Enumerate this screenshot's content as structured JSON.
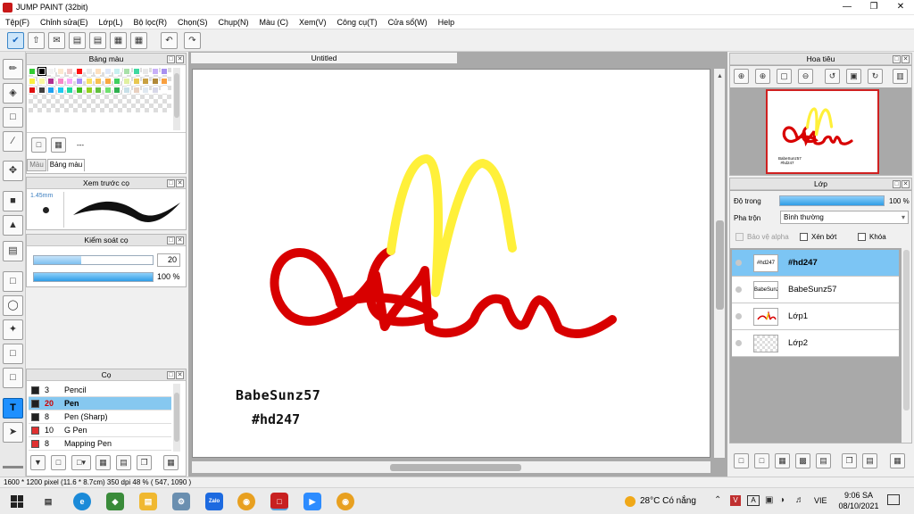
{
  "window": {
    "title": "JUMP PAINT (32bit)"
  },
  "menu": [
    "Tệp(F)",
    "Chỉnh sửa(E)",
    "Lớp(L)",
    "Bộ lọc(R)",
    "Chọn(S)",
    "Chụp(N)",
    "Màu (C)",
    "Xem(V)",
    "Công cụ(T)",
    "Cửa sổ(W)",
    "Help"
  ],
  "palette": {
    "title": "Bảng màu",
    "tabs": [
      "Màu",
      "Bảng màu"
    ],
    "dash": "---",
    "colors": [
      "#33cc33",
      "#000000",
      "#f4f4f4",
      "#fbe8d0",
      "#f4c8c8",
      "#ff1010",
      "#e8e8e8",
      "#fde0c0",
      "#e0e8f8",
      "#c8f0f0",
      "#a8e0a8",
      "#40d8a0",
      "#e8e8e8",
      "#c8b0f8",
      "#a890f0",
      "#f8f040",
      "#f8f8a0",
      "#b03090",
      "#f888c8",
      "#f8a8f8",
      "#a890f8",
      "#f8e060",
      "#f8c050",
      "#f8a840",
      "#40d060",
      "#e0f0a0",
      "#e8c850",
      "#c8a040",
      "#b08838",
      "#f8a040",
      "#e01010",
      "#404040",
      "#20a0f0",
      "#20c8f0",
      "#20d8a0",
      "#40c020",
      "#90d020",
      "#60c040",
      "#70e070",
      "#30b050",
      "#c8e0e8",
      "#e8d0c0",
      "#e0e8f0",
      "#d8d8e8",
      "#ffffff"
    ]
  },
  "brush_preview": {
    "title": "Xem trước cọ",
    "size": "1.45mm"
  },
  "brush_control": {
    "title": "Kiểm soát cọ",
    "size_value": "20",
    "opacity_value": "100 %",
    "size_fill": 0.4,
    "opacity_fill": 1.0
  },
  "brushes": {
    "title": "Cọ",
    "items": [
      {
        "num": "3",
        "name": "Pencil",
        "color": "#202020",
        "selected": false
      },
      {
        "num": "20",
        "name": "Pen",
        "color": "#202020",
        "selected": true
      },
      {
        "num": "8",
        "name": "Pen (Sharp)",
        "color": "#202020",
        "selected": false
      },
      {
        "num": "10",
        "name": "G Pen",
        "color": "#e03030",
        "selected": false
      },
      {
        "num": "8",
        "name": "Mapping Pen",
        "color": "#e03030",
        "selected": false
      }
    ]
  },
  "document": {
    "tab": "Untitled",
    "text_line1": "BabeSunz57",
    "text_line2": "#hd247",
    "stroke_red": "#d80000",
    "stroke_yellow": "#fff03a"
  },
  "navigator": {
    "title": "Hoa tiêu"
  },
  "layers": {
    "title": "Lớp",
    "opacity_label": "Độ trong",
    "opacity_value": "100 %",
    "blend_label": "Pha trộn",
    "blend_value": "Bình thường",
    "protect_alpha": "Bảo vệ alpha",
    "clipping": "Xén bớt",
    "lock": "Khóa",
    "items": [
      {
        "name": "#hd247",
        "thumb": "#hd247",
        "selected": true
      },
      {
        "name": "BabeSunz57",
        "thumb": "BabeSunz57",
        "selected": false
      },
      {
        "name": "Lớp1",
        "thumb": "",
        "selected": false
      },
      {
        "name": "Lớp2",
        "thumb": "",
        "selected": false
      }
    ]
  },
  "status": {
    "text": "1600 * 1200 pixel   (11.6 * 8.7cm)   350 dpi   48 %   ( 547, 1090 )"
  },
  "taskbar": {
    "weather": "28°C  Có nắng",
    "lang": "VIE",
    "time": "9:06 SA",
    "date": "08/10/2021",
    "zalo": "Zalo"
  }
}
